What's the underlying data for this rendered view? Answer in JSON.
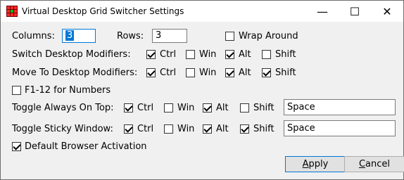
{
  "window": {
    "title": "Virtual Desktop Grid Switcher Settings"
  },
  "controls": {
    "minimize": "—",
    "maximize": "☐",
    "close": "✕"
  },
  "grid": {
    "columns_label": "Columns:",
    "columns_value": "3",
    "rows_label": "Rows:",
    "rows_value": "3",
    "wrap_label": "Wrap Around",
    "wrap_checked": false
  },
  "modifiers": {
    "ctrl": "Ctrl",
    "win": "Win",
    "alt": "Alt",
    "shift": "Shift"
  },
  "switch": {
    "label": "Switch Desktop Modifiers:",
    "ctrl": true,
    "win": false,
    "alt": true,
    "shift": false
  },
  "move": {
    "label": "Move To Desktop Modifiers:",
    "ctrl": true,
    "win": false,
    "alt": true,
    "shift": true
  },
  "f1": {
    "label": "F1-12 for Numbers",
    "checked": false
  },
  "toggle_top": {
    "label": "Toggle Always On Top:",
    "ctrl": true,
    "win": false,
    "alt": true,
    "shift": false,
    "key": "Space"
  },
  "toggle_sticky": {
    "label": "Toggle Sticky Window:",
    "ctrl": true,
    "win": false,
    "alt": true,
    "shift": true,
    "key": "Space"
  },
  "browser": {
    "label": "Default Browser Activation",
    "checked": true
  },
  "buttons": {
    "apply_first": "A",
    "apply_rest": "pply",
    "cancel_first": "C",
    "cancel_rest": "ancel"
  }
}
